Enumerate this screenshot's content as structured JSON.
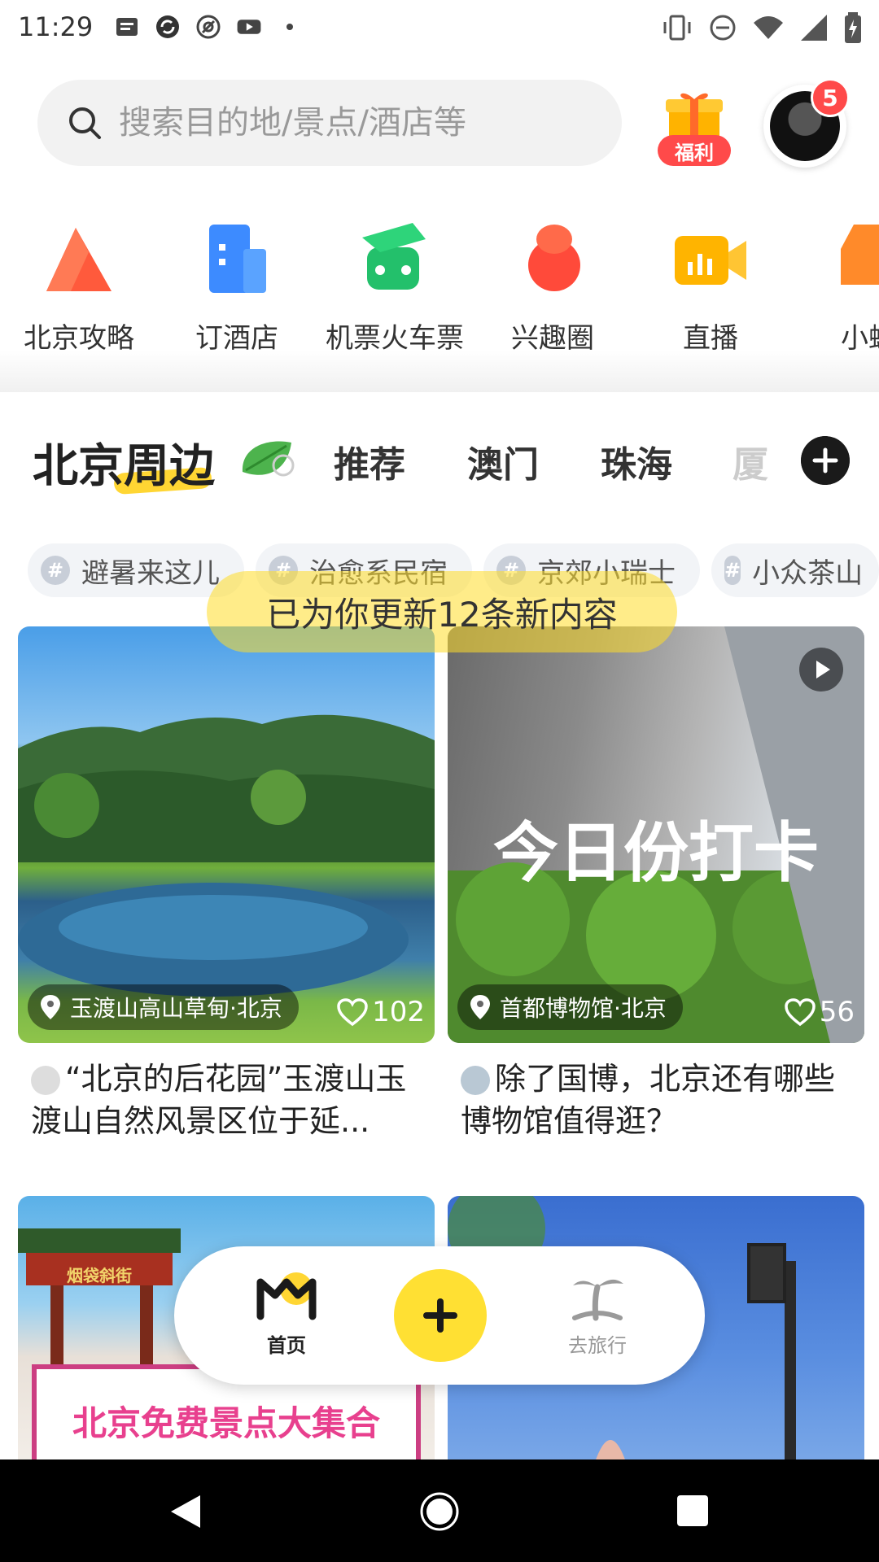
{
  "status_bar": {
    "time": "11:29"
  },
  "search": {
    "placeholder": "搜索目的地/景点/酒店等"
  },
  "welfare": {
    "label": "福利"
  },
  "avatar": {
    "badge_count": "5"
  },
  "quick_nav": [
    {
      "label": "北京攻略",
      "icon": "mountain-icon",
      "color": "#ff5a3c"
    },
    {
      "label": "订酒店",
      "icon": "hotel-icon",
      "color": "#3d8bff"
    },
    {
      "label": "机票火车票",
      "icon": "plane-train-icon",
      "color": "#23c06b"
    },
    {
      "label": "兴趣圈",
      "icon": "interest-circle-icon",
      "color": "#ff4a3a"
    },
    {
      "label": "直播",
      "icon": "live-icon",
      "color": "#ffb400"
    },
    {
      "label": "小蜂",
      "icon": "bee-icon",
      "color": "#ff8a2a"
    }
  ],
  "channels": {
    "active": "北京周边",
    "tabs": [
      "推荐",
      "澳门",
      "珠海",
      "厦"
    ]
  },
  "chips": [
    "避暑来这儿",
    "治愈系民宿",
    "京郊小瑞士",
    "小众茶山"
  ],
  "toast": "已为你更新12条新内容",
  "cards": [
    {
      "location": "玉渡山高山草甸·北京",
      "likes": "102",
      "title": "“北京的后花园”玉渡山玉渡山自然风景区位于延..."
    },
    {
      "location": "首都博物馆·北京",
      "likes": "56",
      "title": "除了国博，北京还有哪些博物馆值得逛？",
      "overlay_text": "今日份打卡"
    },
    {
      "overlay_text": "北京免费景点大集合",
      "gate_text": "烟袋斜街"
    },
    {}
  ],
  "bottom_nav": {
    "home": "首页",
    "travel": "去旅行"
  },
  "colors": {
    "brand_yellow": "#ffe033",
    "badge_red": "#ff4a4a"
  }
}
